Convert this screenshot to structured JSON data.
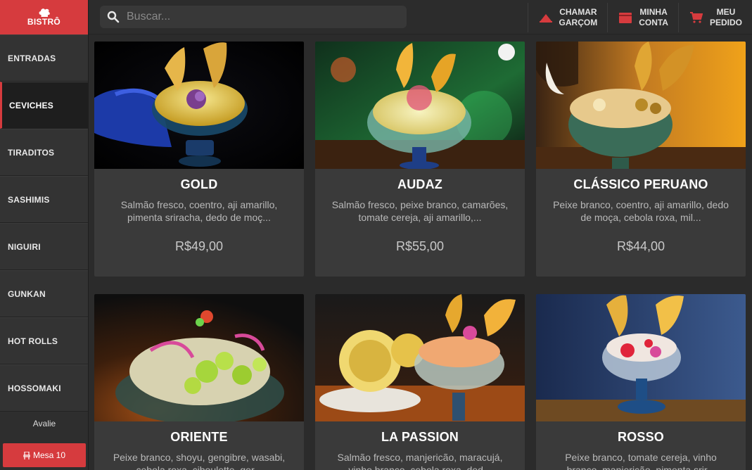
{
  "brand": {
    "name": "BISTRÔ",
    "accent": "#d63b3e"
  },
  "search": {
    "placeholder": "Buscar..."
  },
  "header_actions": [
    {
      "line1": "CHAMAR",
      "line2": "GARÇOM",
      "icon": "waiter-bell-icon"
    },
    {
      "line1": "MINHA",
      "line2": "CONTA",
      "icon": "bill-icon"
    },
    {
      "line1": "MEU",
      "line2": "PEDIDO",
      "icon": "cart-icon"
    }
  ],
  "sidebar": {
    "items": [
      {
        "label": "ENTRADAS"
      },
      {
        "label": "CEVICHES"
      },
      {
        "label": "TIRADITOS"
      },
      {
        "label": "SASHIMIS"
      },
      {
        "label": "NIGUIRI"
      },
      {
        "label": "GUNKAN"
      },
      {
        "label": "HOT ROLLS"
      },
      {
        "label": "HOSSOMAKI"
      }
    ],
    "active": "CEVICHES",
    "avalie": "Avalie",
    "mesa": "Mesa 10"
  },
  "products": [
    {
      "name": "GOLD",
      "desc": "Salmão fresco, coentro, aji amarillo, pimenta sriracha, dedo de moç...",
      "price": "R$49,00"
    },
    {
      "name": "AUDAZ",
      "desc": "Salmão fresco, peixe branco, camarões, tomate cereja, aji amarillo,...",
      "price": "R$55,00"
    },
    {
      "name": "CLÁSSICO PERUANO",
      "desc": "Peixe branco, coentro, aji amarillo, dedo de moça, cebola roxa, mil...",
      "price": "R$44,00"
    },
    {
      "name": "ORIENTE",
      "desc": "Peixe branco, shoyu, gengibre, wasabi, cebola roxa, ciboulette, ger...",
      "price": ""
    },
    {
      "name": "LA PASSION",
      "desc": "Salmão fresco, manjericão, maracujá, vinho branco, cebola roxa, ded...",
      "price": ""
    },
    {
      "name": "ROSSO",
      "desc": "Peixe branco, tomate cereja, vinho branco, manjericão, pimenta srir...",
      "price": ""
    }
  ]
}
